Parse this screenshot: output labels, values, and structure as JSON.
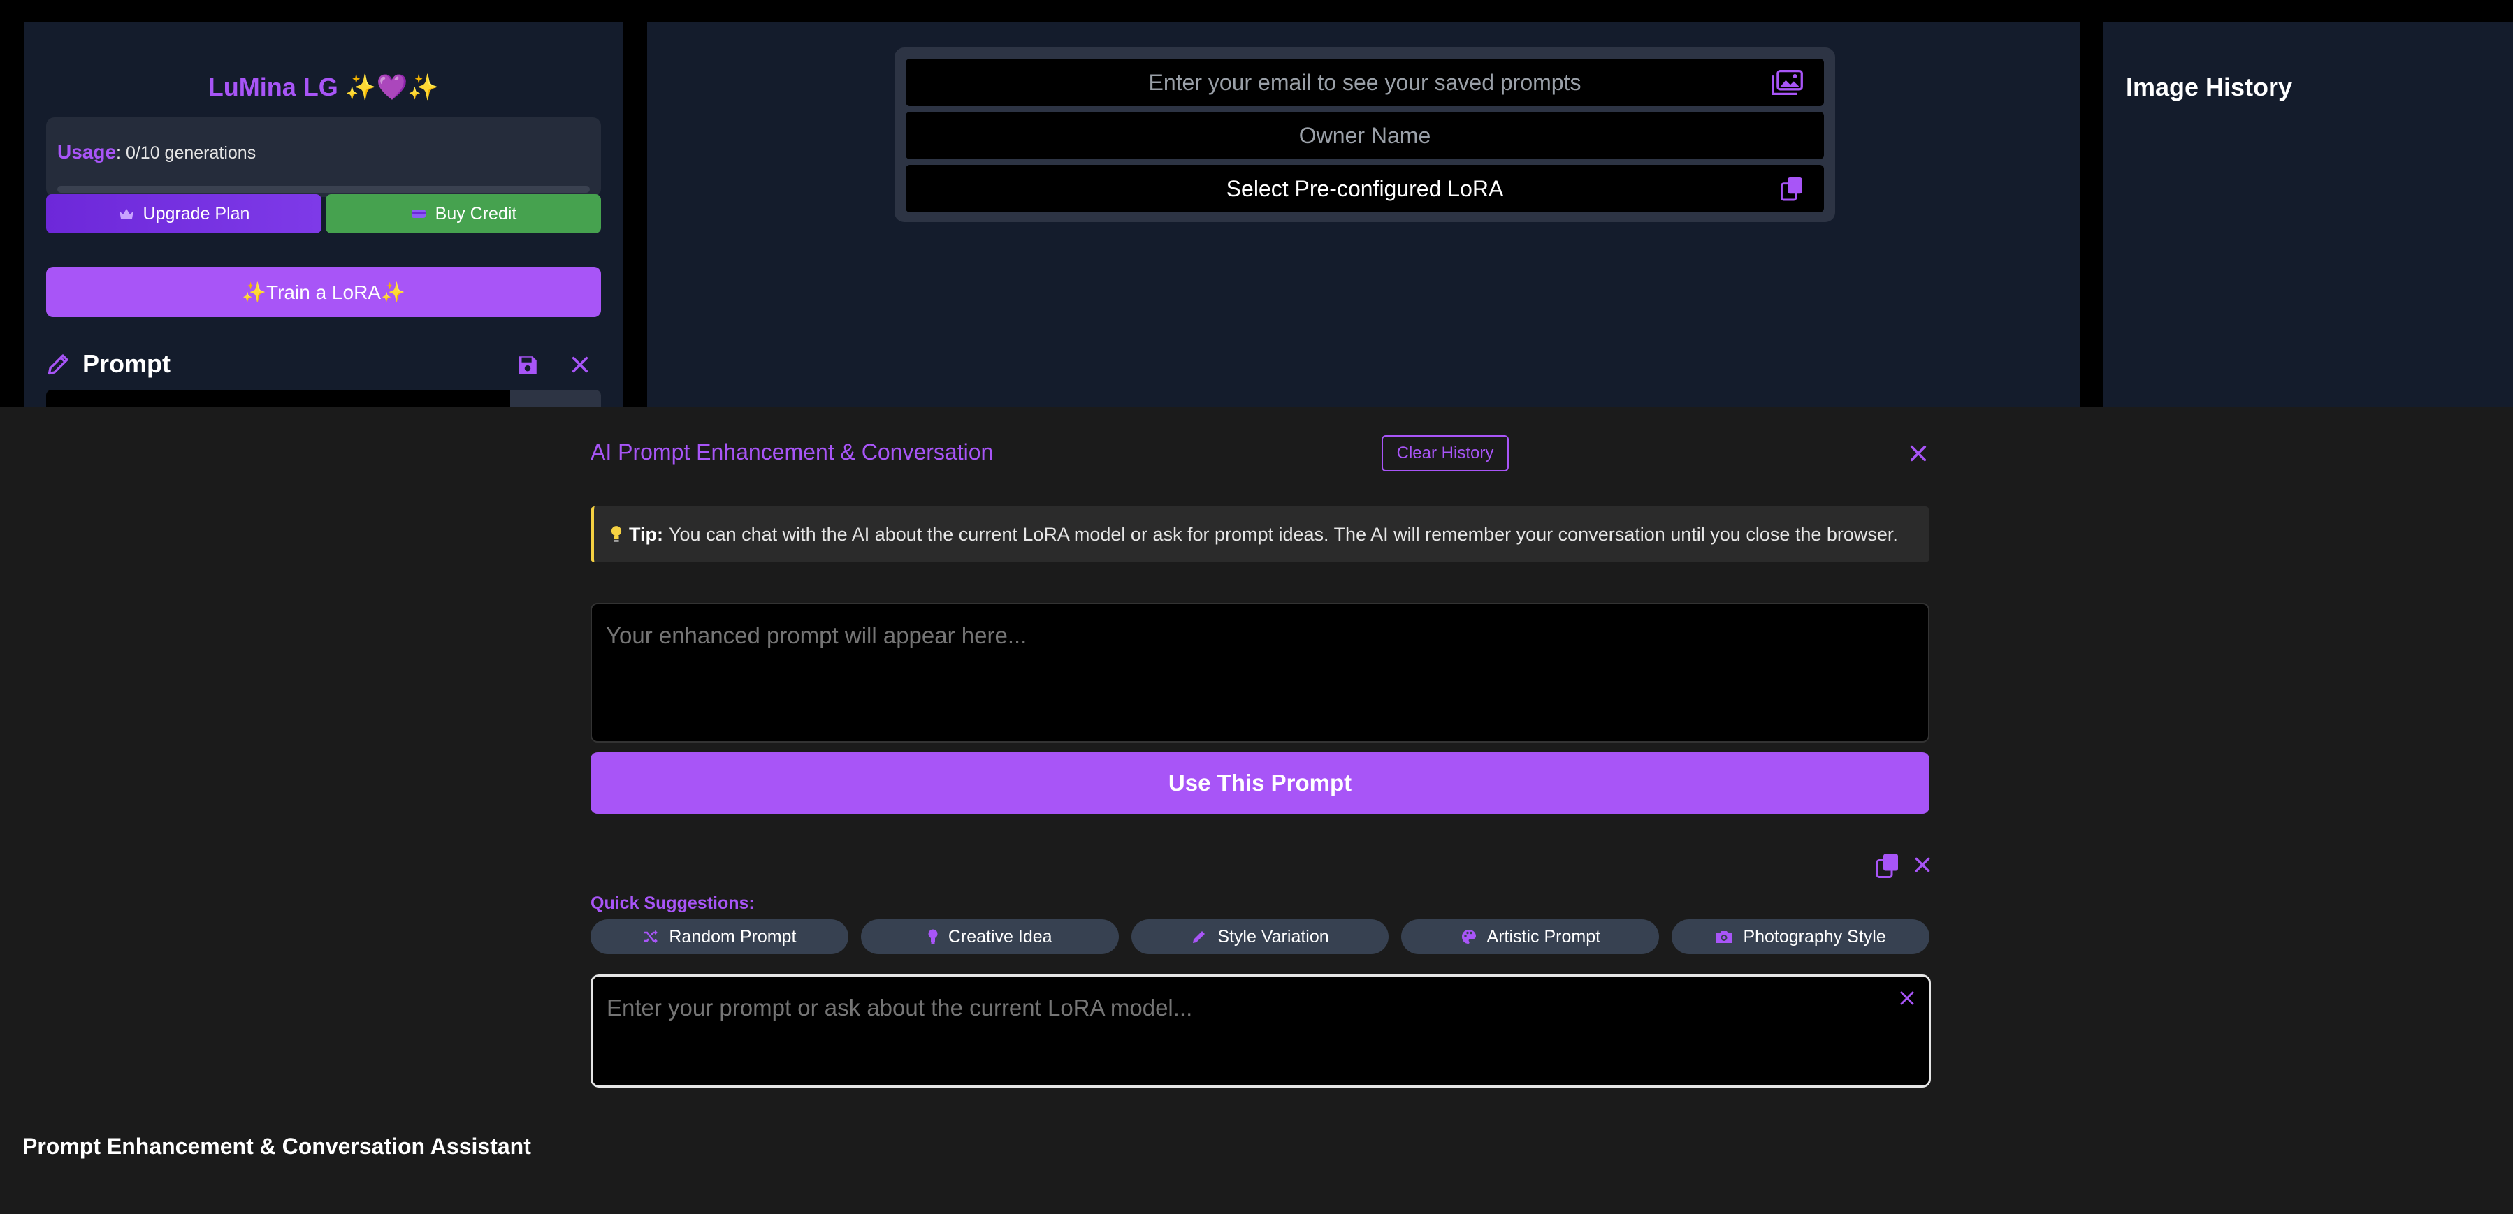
{
  "sidebar": {
    "brand": "LuMina LG ✨💜✨",
    "usage": {
      "label": "Usage",
      "text": ": 0/10 generations",
      "progress": 0
    },
    "upgrade_label": "Upgrade Plan",
    "credit_label": "Buy Credit",
    "train_label": "✨Train a LoRA✨",
    "prompt_label": "Prompt"
  },
  "main": {
    "email_placeholder": "Enter your email to see your saved prompts",
    "owner_placeholder": "Owner Name",
    "lora_select": "Select Pre-configured LoRA"
  },
  "history": {
    "title": "Image History"
  },
  "panel": {
    "title": "AI Prompt Enhancement & Conversation",
    "clear_history": "Clear History",
    "tip_label": "Tip:",
    "tip_text": "You can chat with the AI about the current LoRA model or ask for prompt ideas. The AI will remember your conversation until you close the browser.",
    "enhanced_placeholder": "Your enhanced prompt will appear here...",
    "use_prompt": "Use This Prompt",
    "quick_suggestions_label": "Quick Suggestions:",
    "suggestions": [
      {
        "label": "Random Prompt",
        "icon": "shuffle-icon"
      },
      {
        "label": "Creative Idea",
        "icon": "lightbulb-icon"
      },
      {
        "label": "Style Variation",
        "icon": "pencil-icon"
      },
      {
        "label": "Artistic Prompt",
        "icon": "palette-icon"
      },
      {
        "label": "Photography Style",
        "icon": "camera-icon"
      }
    ],
    "chat_placeholder": "Enter your prompt or ask about the current LoRA model...",
    "assistant_label": "Prompt Enhancement & Conversation Assistant"
  },
  "colors": {
    "accent": "#a855f7",
    "success": "#46a24f",
    "panel_bg": "#1b1b1b",
    "card_bg": "#141c2c",
    "tip_border": "#f5d142"
  }
}
